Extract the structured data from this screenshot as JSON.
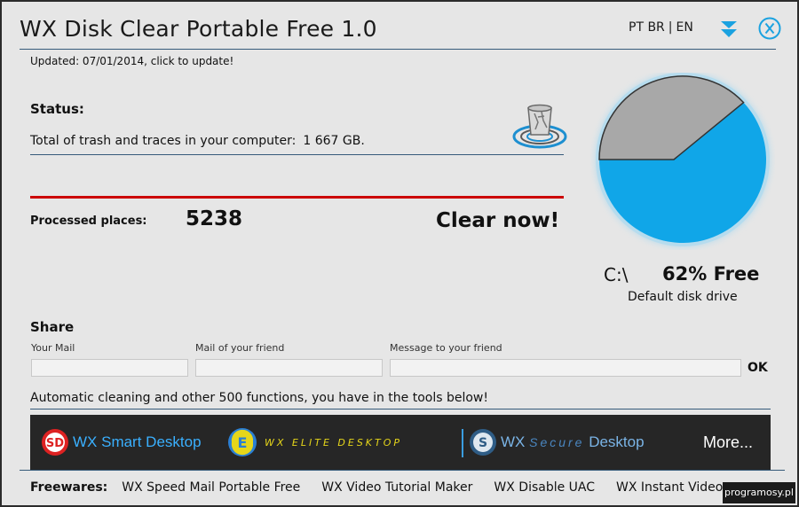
{
  "window": {
    "title": "WX Disk Clear Portable Free 1.0",
    "lang_pt": "PT BR",
    "lang_sep": "|",
    "lang_en": "EN"
  },
  "update_text": "Updated: 07/01/2014, click to update!",
  "status": {
    "title": "Status:",
    "trash_label": "Total of trash and traces in your computer:",
    "trash_value": "1 667 GB."
  },
  "processed": {
    "label": "Processed places:",
    "value": "5238",
    "clear_button": "Clear now!"
  },
  "disk": {
    "drive": "C:\\",
    "free_label": "62% Free",
    "free_fraction": 0.62,
    "subtitle": "Default disk drive",
    "free_color": "#10a6e8",
    "used_color": "#a8a8a8"
  },
  "share": {
    "title": "Share",
    "mail_label": "Your Mail",
    "friend_label": "Mail of your friend",
    "message_label": "Message to your friend",
    "ok_label": "OK"
  },
  "tools_text": "Automatic cleaning and other 500 functions, you have in the tools below!",
  "banner": {
    "smart": "WX Smart Desktop",
    "elite": "WX ELITE DESKTOP",
    "secure_prefix": "WX ",
    "secure_word": "Secure",
    "secure_suffix": " Desktop",
    "more": "More..."
  },
  "freewares": {
    "label": "Freewares:",
    "items": [
      "WX Speed Mail Portable Free",
      "WX Video Tutorial Maker",
      "WX Disable UAC",
      "WX Instant Video"
    ]
  },
  "watermark": "programosy.pl",
  "icons": [
    "arrow-down-double-icon",
    "close-circle-icon",
    "trash-bin-icon",
    "wx-smart-logo-icon",
    "wx-elite-logo-icon",
    "wx-secure-logo-icon"
  ]
}
